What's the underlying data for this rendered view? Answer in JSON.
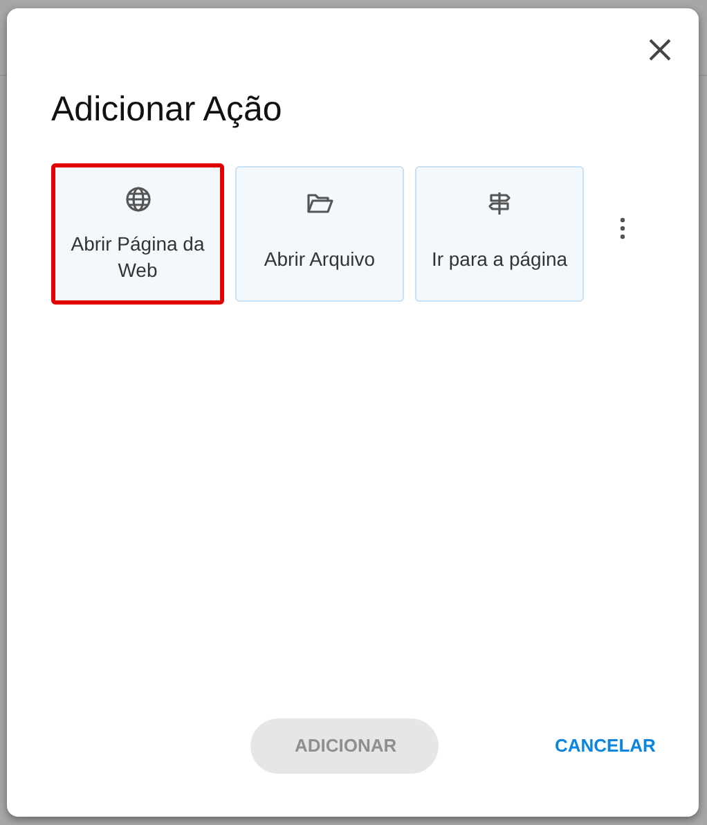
{
  "dialog": {
    "title": "Adicionar Ação",
    "actions": [
      {
        "kind": "globe",
        "label": "Abrir Página da Web",
        "highlighted": true
      },
      {
        "kind": "folder",
        "label": "Abrir Arquivo",
        "highlighted": false
      },
      {
        "kind": "signpost",
        "label": "Ir para a página",
        "highlighted": false
      }
    ],
    "buttons": [
      {
        "label": "ADICIONAR",
        "disabled": true
      },
      {
        "label": "CANCELAR",
        "disabled": false
      }
    ]
  }
}
